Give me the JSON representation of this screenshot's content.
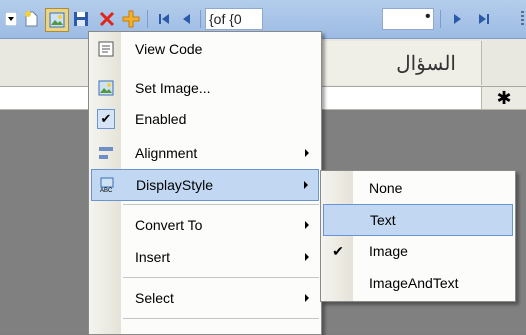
{
  "toolbar": {
    "position_text": "{of {0",
    "icons": [
      "dropdown-icon",
      "new-icon",
      "image-icon",
      "save-icon",
      "delete-icon",
      "add-icon",
      "move-first-icon",
      "move-previous-icon",
      "move-next-icon",
      "move-last-icon"
    ]
  },
  "grid": {
    "column_header": "السؤال",
    "new_row_marker": "✱"
  },
  "context_menu": {
    "items": [
      {
        "label": "View Code"
      },
      {
        "label": "Set Image..."
      },
      {
        "label": "Enabled",
        "checked": true
      },
      {
        "label": "Alignment",
        "submenu": true
      },
      {
        "label": "DisplayStyle",
        "submenu": true,
        "highlighted": true
      },
      {
        "label": "Convert To",
        "submenu": true
      },
      {
        "label": "Insert",
        "submenu": true
      },
      {
        "label": "Select",
        "submenu": true
      }
    ]
  },
  "submenu": {
    "items": [
      {
        "label": "None"
      },
      {
        "label": "Text",
        "highlighted": true
      },
      {
        "label": "Image",
        "checked": true
      },
      {
        "label": "ImageAndText"
      }
    ]
  },
  "colors": {
    "toolbar_bg": "#b4cdec",
    "highlight": "#c2d8f2",
    "highlight_border": "#6b95d1",
    "grid_bg": "#808080"
  }
}
